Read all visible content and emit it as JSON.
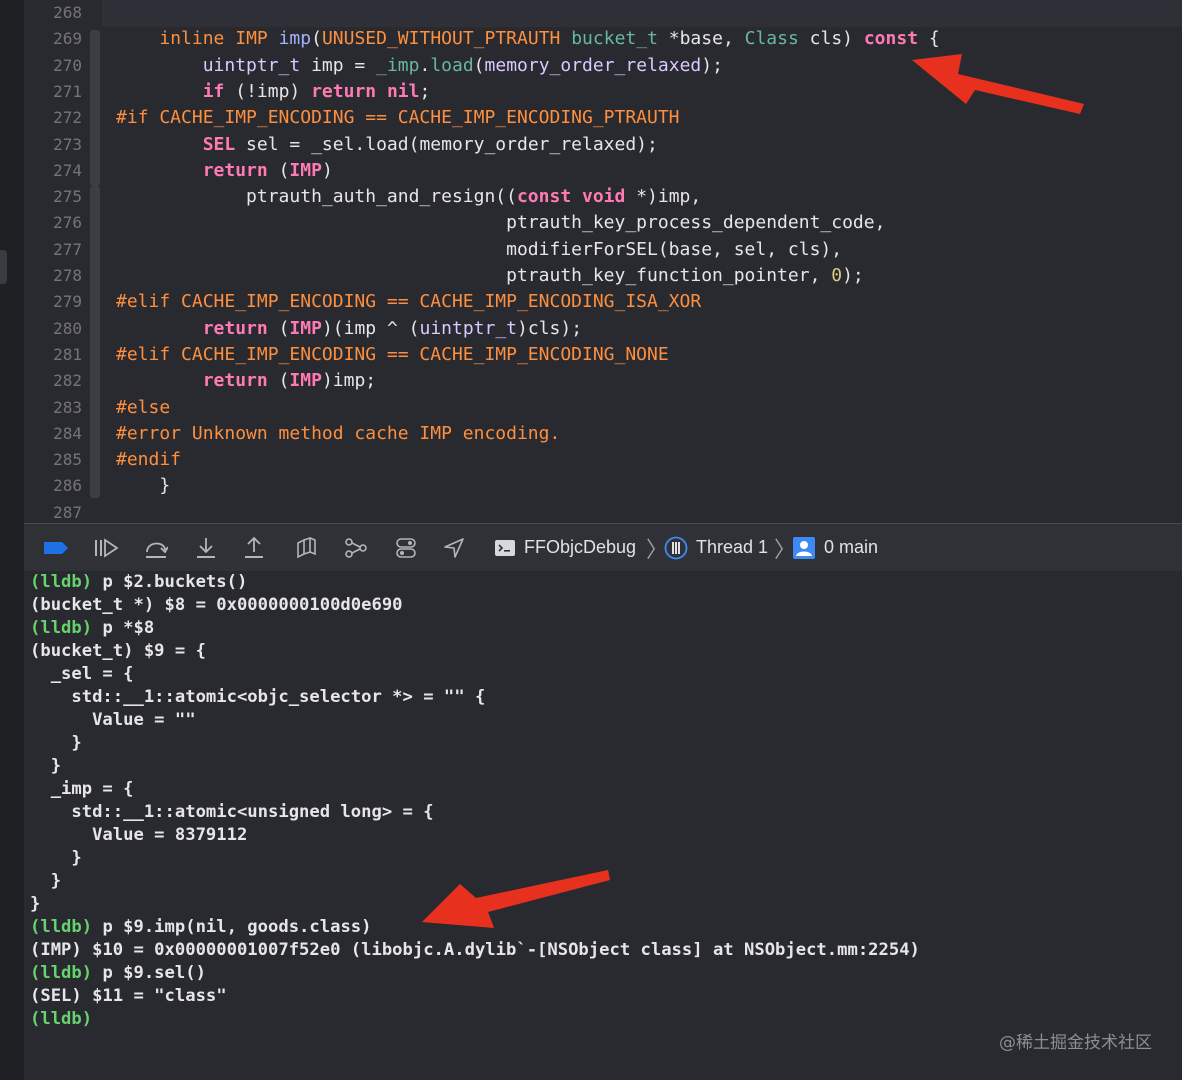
{
  "editor": {
    "line_numbers": [
      "268",
      "269",
      "270",
      "271",
      "272",
      "273",
      "274",
      "275",
      "276",
      "277",
      "278",
      "279",
      "280",
      "281",
      "282",
      "283",
      "284",
      "285",
      "286",
      "287"
    ],
    "lines": [
      [],
      [
        [
          "    ",
          "pl"
        ],
        [
          "inline",
          "pp"
        ],
        [
          " ",
          "pl"
        ],
        [
          "IMP",
          "pp"
        ],
        [
          " ",
          "pl"
        ],
        [
          "imp",
          "fnv"
        ],
        [
          "(",
          "pl"
        ],
        [
          "UNUSED_WITHOUT_PTRAUTH",
          "pp"
        ],
        [
          " ",
          "pl"
        ],
        [
          "bucket_t",
          "fn"
        ],
        [
          " *base, ",
          "pl"
        ],
        [
          "Class",
          "fn"
        ],
        [
          " cls) ",
          "pl"
        ],
        [
          "const",
          "kw"
        ],
        [
          " {",
          "pl"
        ]
      ],
      [
        [
          "        ",
          "pl"
        ],
        [
          "uintptr_t",
          "ty"
        ],
        [
          " imp = ",
          "pl"
        ],
        [
          "_imp",
          "fn"
        ],
        [
          ".",
          "pl"
        ],
        [
          "load",
          "fn"
        ],
        [
          "(",
          "pl"
        ],
        [
          "memory_order_relaxed",
          "ty"
        ],
        [
          ");",
          "pl"
        ]
      ],
      [
        [
          "        ",
          "pl"
        ],
        [
          "if",
          "kw"
        ],
        [
          " (!imp) ",
          "pl"
        ],
        [
          "return",
          "kw"
        ],
        [
          " ",
          "pl"
        ],
        [
          "nil",
          "kw"
        ],
        [
          ";",
          "pl"
        ]
      ],
      [
        [
          "#if CACHE_IMP_ENCODING == CACHE_IMP_ENCODING_PTRAUTH",
          "pp"
        ]
      ],
      [
        [
          "        ",
          "pl"
        ],
        [
          "SEL",
          "kw"
        ],
        [
          " sel = _sel.load(memory_order_relaxed);",
          "pl"
        ]
      ],
      [
        [
          "        ",
          "pl"
        ],
        [
          "return",
          "kw"
        ],
        [
          " (",
          "pl"
        ],
        [
          "IMP",
          "kw"
        ],
        [
          ")",
          "pl"
        ]
      ],
      [
        [
          "            ptrauth_auth_and_resign((",
          "pl"
        ],
        [
          "const",
          "kw"
        ],
        [
          " ",
          "pl"
        ],
        [
          "void",
          "kw"
        ],
        [
          " *)imp,",
          "pl"
        ]
      ],
      [
        [
          "                                    ptrauth_key_process_dependent_code,",
          "pl"
        ]
      ],
      [
        [
          "                                    modifierForSEL(base, sel, cls),",
          "pl"
        ]
      ],
      [
        [
          "                                    ptrauth_key_function_pointer, ",
          "pl"
        ],
        [
          "0",
          "num"
        ],
        [
          ");",
          "pl"
        ]
      ],
      [
        [
          "#elif CACHE_IMP_ENCODING == CACHE_IMP_ENCODING_ISA_XOR",
          "pp"
        ]
      ],
      [
        [
          "        ",
          "pl"
        ],
        [
          "return",
          "kw"
        ],
        [
          " (",
          "pl"
        ],
        [
          "IMP",
          "kw"
        ],
        [
          ")(imp ^ (",
          "pl"
        ],
        [
          "uintptr_t",
          "ty"
        ],
        [
          ")cls);",
          "pl"
        ]
      ],
      [
        [
          "#elif CACHE_IMP_ENCODING == CACHE_IMP_ENCODING_NONE",
          "pp"
        ]
      ],
      [
        [
          "        ",
          "pl"
        ],
        [
          "return",
          "kw"
        ],
        [
          " (",
          "pl"
        ],
        [
          "IMP",
          "kw"
        ],
        [
          ")imp;",
          "pl"
        ]
      ],
      [
        [
          "#else",
          "pp"
        ]
      ],
      [
        [
          "#error Unknown method cache IMP encoding.",
          "pp"
        ]
      ],
      [
        [
          "#endif",
          "pp"
        ]
      ],
      [
        [
          "    }",
          "pl"
        ]
      ],
      []
    ]
  },
  "toolbar": {
    "icons": [
      "breakpoint-toggle-icon",
      "continue-icon",
      "step-over-icon",
      "step-into-icon",
      "step-out-icon",
      "debug-view-hierarchy-icon",
      "memory-graph-icon",
      "environment-overrides-icon",
      "simulate-location-icon"
    ],
    "breadcrumb": {
      "target": "FFObjcDebug",
      "thread": "Thread 1",
      "frame": "0 main"
    }
  },
  "console": {
    "lines": [
      [
        [
          "(lldb)",
          "prompt"
        ],
        [
          " p $2.buckets()",
          "pl"
        ]
      ],
      [
        [
          "(bucket_t *) $8 = 0x0000000100d0e690",
          "pl"
        ]
      ],
      [
        [
          "(lldb)",
          "prompt"
        ],
        [
          " p *$8",
          "pl"
        ]
      ],
      [
        [
          "(bucket_t) $9 = {",
          "pl"
        ]
      ],
      [
        [
          "  _sel = {",
          "pl"
        ]
      ],
      [
        [
          "    std::__1::atomic<objc_selector *> = \"\" {",
          "pl"
        ]
      ],
      [
        [
          "      Value = \"\"",
          "pl"
        ]
      ],
      [
        [
          "    }",
          "pl"
        ]
      ],
      [
        [
          "  }",
          "pl"
        ]
      ],
      [
        [
          "  _imp = {",
          "pl"
        ]
      ],
      [
        [
          "    std::__1::atomic<unsigned long> = {",
          "pl"
        ]
      ],
      [
        [
          "      Value = 8379112",
          "pl"
        ]
      ],
      [
        [
          "    }",
          "pl"
        ]
      ],
      [
        [
          "  }",
          "pl"
        ]
      ],
      [
        [
          "}",
          "pl"
        ]
      ],
      [
        [
          "(lldb)",
          "prompt"
        ],
        [
          " p $9.imp(nil, goods.class)",
          "pl"
        ]
      ],
      [
        [
          "(IMP) $10 = 0x00000001007f52e0 (libobjc.A.dylib`-[NSObject class] at NSObject.mm:2254)",
          "pl"
        ]
      ],
      [
        [
          "(lldb)",
          "prompt"
        ],
        [
          " p $9.sel()",
          "pl"
        ]
      ],
      [
        [
          "(SEL) $11 = \"class\"",
          "pl"
        ]
      ],
      [
        [
          "(lldb)",
          "prompt"
        ]
      ]
    ]
  },
  "watermark": "@稀土掘金技术社区",
  "colors": {
    "background": "#292a30",
    "keyword": "#ff7ab2",
    "preprocessor": "#fd8f3f",
    "type": "#dac9ff",
    "prompt": "#67d36c",
    "accent": "#1f6fe5",
    "annotation_arrow": "#e8301f"
  }
}
